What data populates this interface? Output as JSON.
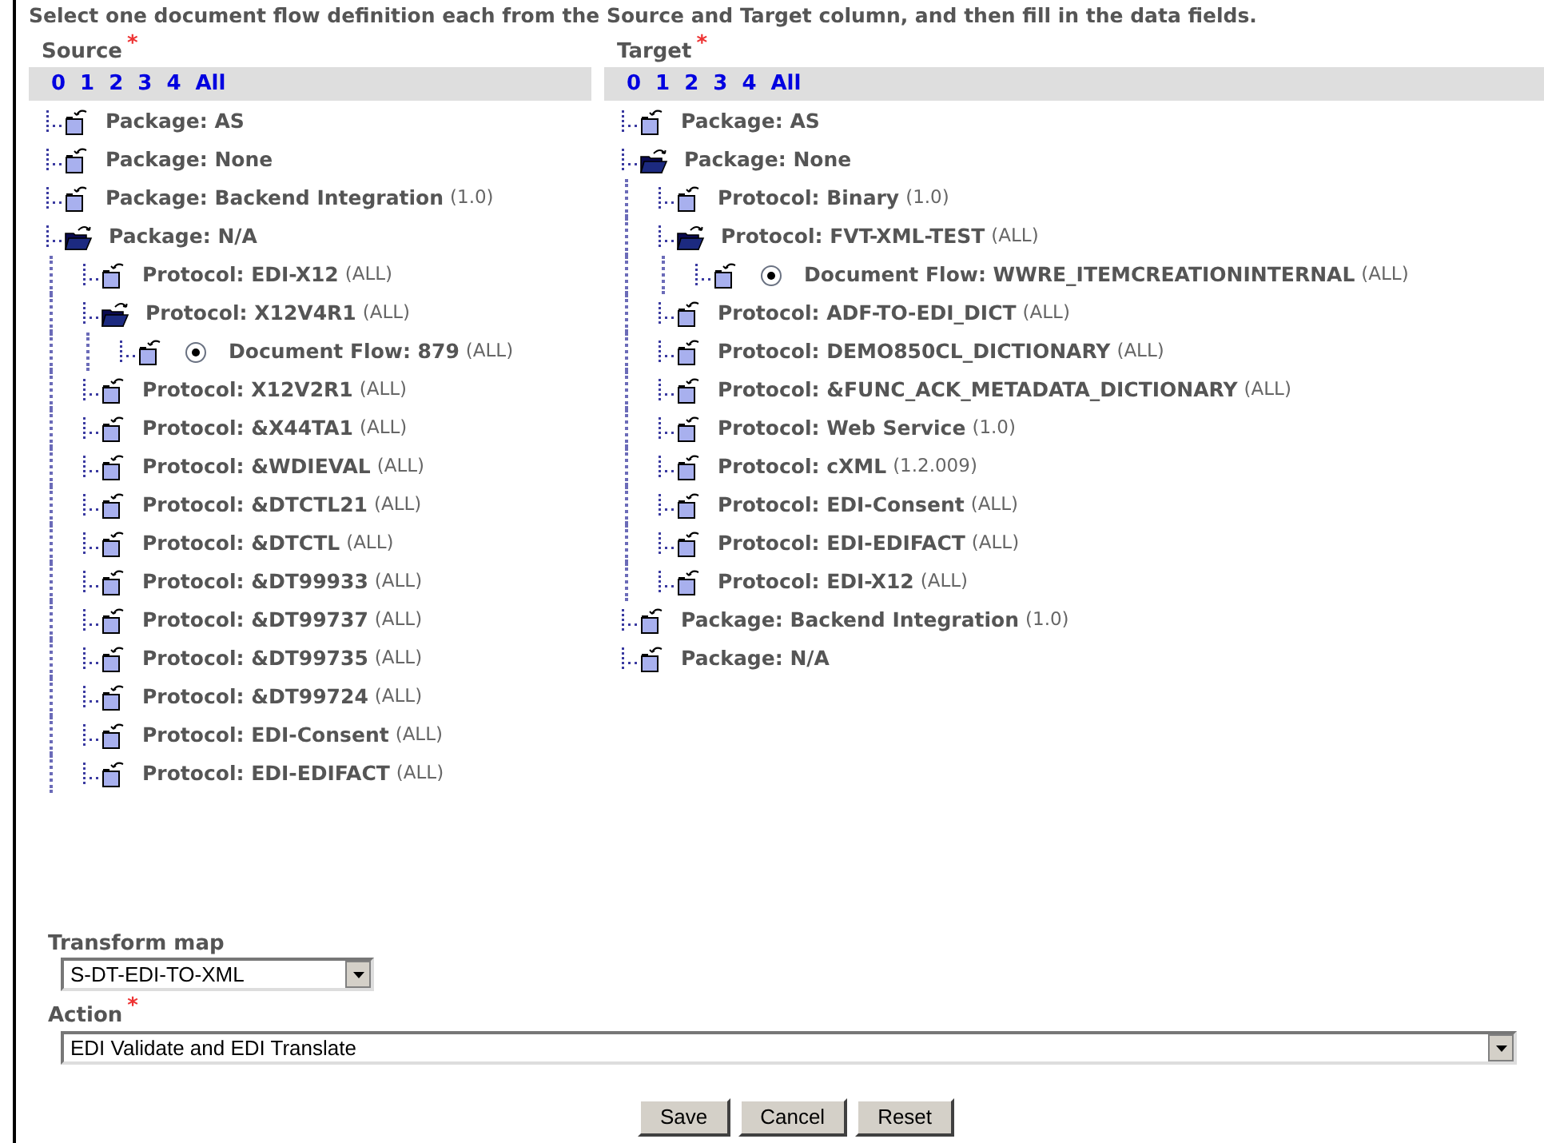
{
  "instruction": "Select one document flow definition each from the Source and Target column, and then fill in the data fields.",
  "columns": [
    {
      "title": "Source",
      "required": "*",
      "levels": [
        "0",
        "1",
        "2",
        "3",
        "4",
        "All"
      ],
      "tree": [
        {
          "label": "Package: AS",
          "expanded": false
        },
        {
          "label": "Package: None",
          "expanded": false
        },
        {
          "label": "Package: Backend Integration",
          "suffix": "(1.0)",
          "expanded": false
        },
        {
          "label": "Package: N/A",
          "expanded": true,
          "children": [
            {
              "label": "Protocol: EDI-X12",
              "suffix": "(ALL)",
              "expanded": false
            },
            {
              "label": "Protocol: X12V4R1",
              "suffix": "(ALL)",
              "expanded": true,
              "children": [
                {
                  "label": "Document Flow: 879",
                  "suffix": "(ALL)",
                  "expanded": false,
                  "selected": true
                }
              ]
            },
            {
              "label": "Protocol: X12V2R1",
              "suffix": "(ALL)",
              "expanded": false
            },
            {
              "label": "Protocol: &X44TA1",
              "suffix": "(ALL)",
              "expanded": false
            },
            {
              "label": "Protocol: &WDIEVAL",
              "suffix": "(ALL)",
              "expanded": false
            },
            {
              "label": "Protocol: &DTCTL21",
              "suffix": "(ALL)",
              "expanded": false
            },
            {
              "label": "Protocol: &DTCTL",
              "suffix": "(ALL)",
              "expanded": false
            },
            {
              "label": "Protocol: &DT99933",
              "suffix": "(ALL)",
              "expanded": false
            },
            {
              "label": "Protocol: &DT99737",
              "suffix": "(ALL)",
              "expanded": false
            },
            {
              "label": "Protocol: &DT99735",
              "suffix": "(ALL)",
              "expanded": false
            },
            {
              "label": "Protocol: &DT99724",
              "suffix": "(ALL)",
              "expanded": false
            },
            {
              "label": "Protocol: EDI-Consent",
              "suffix": "(ALL)",
              "expanded": false
            },
            {
              "label": "Protocol: EDI-EDIFACT",
              "suffix": "(ALL)",
              "expanded": false
            }
          ]
        }
      ]
    },
    {
      "title": "Target",
      "required": "*",
      "levels": [
        "0",
        "1",
        "2",
        "3",
        "4",
        "All"
      ],
      "tree": [
        {
          "label": "Package: AS",
          "expanded": false
        },
        {
          "label": "Package: None",
          "expanded": true,
          "children": [
            {
              "label": "Protocol: Binary",
              "suffix": "(1.0)",
              "expanded": false
            },
            {
              "label": "Protocol: FVT-XML-TEST",
              "suffix": "(ALL)",
              "expanded": true,
              "children": [
                {
                  "label": "Document Flow: WWRE_ITEMCREATIONINTERNAL",
                  "suffix": "(ALL)",
                  "expanded": false,
                  "selected": true
                }
              ]
            },
            {
              "label": "Protocol: ADF-TO-EDI_DICT",
              "suffix": "(ALL)",
              "expanded": false
            },
            {
              "label": "Protocol: DEMO850CL_DICTIONARY",
              "suffix": "(ALL)",
              "expanded": false
            },
            {
              "label": "Protocol: &FUNC_ACK_METADATA_DICTIONARY",
              "suffix": "(ALL)",
              "expanded": false
            },
            {
              "label": "Protocol: Web Service",
              "suffix": "(1.0)",
              "expanded": false
            },
            {
              "label": "Protocol: cXML",
              "suffix": "(1.2.009)",
              "expanded": false
            },
            {
              "label": "Protocol: EDI-Consent",
              "suffix": "(ALL)",
              "expanded": false
            },
            {
              "label": "Protocol: EDI-EDIFACT",
              "suffix": "(ALL)",
              "expanded": false
            },
            {
              "label": "Protocol: EDI-X12",
              "suffix": "(ALL)",
              "expanded": false
            }
          ]
        },
        {
          "label": "Package: Backend Integration",
          "suffix": "(1.0)",
          "expanded": false
        },
        {
          "label": "Package: N/A",
          "expanded": false
        }
      ]
    }
  ],
  "transform_map": {
    "label": "Transform map",
    "value": "S-DT-EDI-TO-XML"
  },
  "action": {
    "label": "Action",
    "required": "*",
    "value": "EDI Validate and EDI Translate"
  },
  "buttons": [
    "Save",
    "Cancel",
    "Reset"
  ]
}
